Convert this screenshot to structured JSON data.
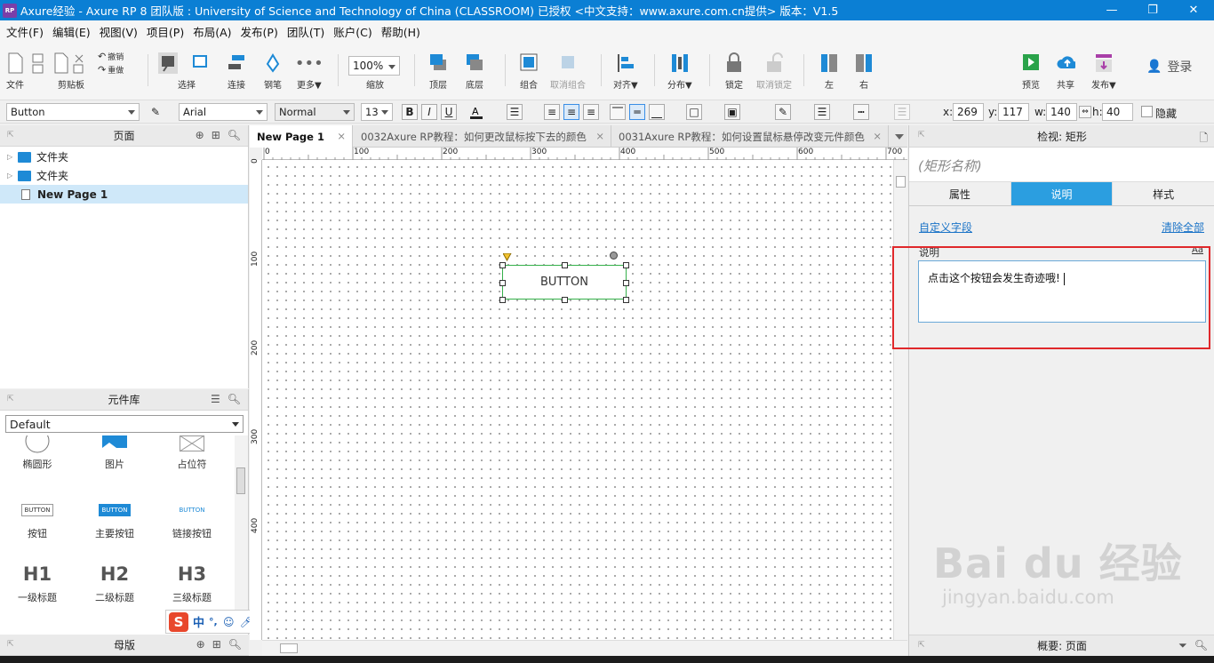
{
  "titlebar": {
    "logo": "RP",
    "title": "Axure经验 - Axure RP 8 团队版 : University of Science and Technology of China (CLASSROOM) 已授权    <中文支持：www.axure.com.cn提供> 版本：V1.5",
    "minimize": "—",
    "restore": "❐",
    "close": "✕"
  },
  "menu": [
    "文件(F)",
    "编辑(E)",
    "视图(V)",
    "项目(P)",
    "布局(A)",
    "发布(P)",
    "团队(T)",
    "账户(C)",
    "帮助(H)"
  ],
  "toolbar": {
    "file": "文件",
    "clipboard": "剪贴板",
    "undo": "撤销",
    "redo": "重做",
    "select": "选择",
    "connect": "连接",
    "pen": "钢笔",
    "more": "更多▼",
    "zoom_value": "100%",
    "zoom": "缩放",
    "top": "顶层",
    "bottom": "底层",
    "group": "组合",
    "ungroup": "取消组合",
    "align": "对齐▼",
    "distribute": "分布▼",
    "lock": "锁定",
    "unlock": "取消锁定",
    "left": "左",
    "right": "右",
    "preview": "预览",
    "share": "共享",
    "publish": "发布▼",
    "login": "登录"
  },
  "format": {
    "widget_style": "Button",
    "font_family": "Arial",
    "font_style": "Normal",
    "font_size": "13",
    "bold": "B",
    "italic": "I",
    "underline": "U",
    "x_label": "x:",
    "x": "269",
    "y_label": "y:",
    "y": "117",
    "w_label": "w:",
    "w": "140",
    "h_label": "h:",
    "h": "40",
    "hidden": "隐藏"
  },
  "pages_panel": {
    "title": "页面",
    "items": [
      {
        "label": "文件夹",
        "type": "folder"
      },
      {
        "label": "文件夹",
        "type": "folder"
      },
      {
        "label": "New Page 1",
        "type": "page",
        "selected": true
      }
    ]
  },
  "library_panel": {
    "title": "元件库",
    "selected_library": "Default",
    "items": [
      {
        "label": "椭圆形"
      },
      {
        "label": "图片"
      },
      {
        "label": "占位符"
      },
      {
        "label": "按钮",
        "preview": "BUTTON"
      },
      {
        "label": "主要按钮",
        "preview": "BUTTON"
      },
      {
        "label": "链接按钮",
        "preview": "BUTTON"
      },
      {
        "label": "一级标题",
        "preview": "H1"
      },
      {
        "label": "二级标题",
        "preview": "H2"
      },
      {
        "label": "三级标题",
        "preview": "H3"
      }
    ]
  },
  "masters_panel": {
    "title": "母版"
  },
  "tabs": [
    {
      "label": "New Page 1",
      "active": true
    },
    {
      "label": "0032Axure RP教程：如何更改鼠标按下去的颜色"
    },
    {
      "label": "0031Axure RP教程：如何设置鼠标悬停改变元件颜色"
    }
  ],
  "ruler": {
    "top": [
      "0",
      "100",
      "200",
      "300",
      "400",
      "500",
      "600",
      "700"
    ],
    "left": [
      "0",
      "100",
      "200",
      "300",
      "400"
    ]
  },
  "canvas": {
    "widget_text": "BUTTON"
  },
  "inspector": {
    "title": "检视: 矩形",
    "name_placeholder": "(矩形名称)",
    "tabs": [
      "属性",
      "说明",
      "样式"
    ],
    "active_tab": "说明",
    "custom_fields": "自定义字段",
    "clear_all": "清除全部",
    "note_label": "说明",
    "note_format": "Aa",
    "note_text": "点击这个按钮会发生奇迹哦!",
    "footer": "概要: 页面"
  },
  "ime": {
    "mode": "中",
    "punct": "°,"
  },
  "watermark": {
    "main": "Bai du 经验",
    "sub": "jingyan.baidu.com"
  },
  "colors": {
    "titlebar": "#0b7fd4",
    "selected_tab": "#2b9ee0",
    "highlight_box": "#e0282b",
    "widget_border": "#35b04a"
  }
}
